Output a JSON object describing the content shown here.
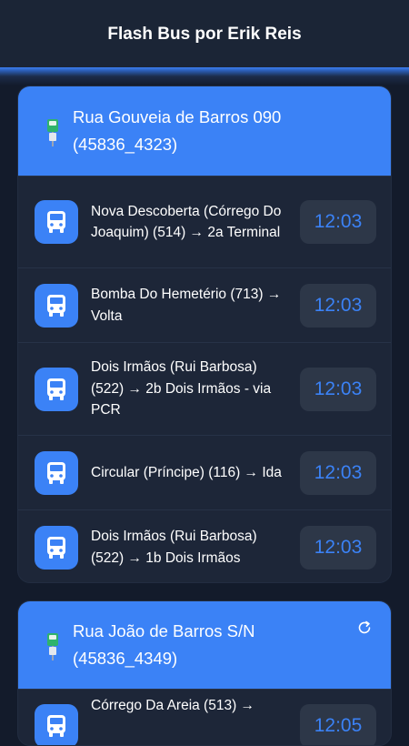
{
  "app": {
    "title": "Flash Bus por Erik Reis"
  },
  "stops": [
    {
      "title": "Rua Gouveia de Barros 090 (45836_4323)",
      "routes": [
        {
          "text": "Nova Descoberta (Córrego Do Joaquim) (514) → 2a Terminal",
          "time": "12:03"
        },
        {
          "text": "Bomba Do Hemetério (713) → Volta",
          "time": "12:03"
        },
        {
          "text": "Dois Irmãos (Rui Barbosa) (522) → 2b Dois Irmãos - via PCR",
          "time": "12:03"
        },
        {
          "text": "Circular (Príncipe) (116) → Ida",
          "time": "12:03"
        },
        {
          "text": "Dois Irmãos (Rui Barbosa) (522) → 1b Dois Irmãos",
          "time": "12:03"
        }
      ]
    },
    {
      "title": "Rua João de Barros S/N (45836_4349)",
      "routes": [
        {
          "text": "Córrego Da Areia (513) →",
          "time": "12:05"
        }
      ]
    }
  ],
  "colors": {
    "accent": "#3b82f6",
    "background": "#131b2b",
    "card": "#1d2638",
    "pill": "#2d3748"
  },
  "icons": {
    "stop": "bus-stop-sign-icon",
    "route": "bus-icon",
    "refresh": "refresh-icon"
  }
}
